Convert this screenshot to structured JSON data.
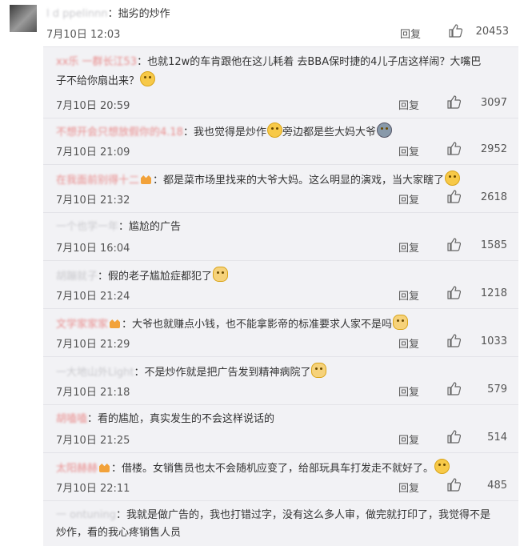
{
  "top_comment": {
    "username": "l  d  ppelinnn",
    "colon_text": "：拙劣的炒作",
    "time": "7月10日 12:03",
    "reply_label": "回复",
    "likes": "20453"
  },
  "replies": [
    {
      "username": "xx乐  一群长江53",
      "text_line1": "：也就12w的车肯跟他在这儿耗着 去BBA保时捷的4儿子店这样闹？大嘴巴",
      "text_line2": "子不给你扇出来？",
      "emoji": "wink-face-icon",
      "time": "7月10日 20:59",
      "reply_label": "回复",
      "likes": "3097"
    },
    {
      "username": "不想开会只想放假你的4.18",
      "text_line1": "：我也觉得是炒作",
      "text_after_emoji": "旁边都是些大妈大爷",
      "emoji": "sleepy-face-icon",
      "emoji2": "crying-face-icon",
      "time": "7月10日 21:09",
      "reply_label": "回复",
      "likes": "2952"
    },
    {
      "username": "在我面前别得十二",
      "text_line1": "：都是菜市场里找来的大爷大妈。这么明显的演戏，当大家瞎了",
      "emoji": "laughing-face-icon",
      "time": "7月10日 21:32",
      "reply_label": "回复",
      "likes": "2618"
    },
    {
      "username": "一个也学一年",
      "text_line1": "：尴尬的广告",
      "time": "7月10日 16:04",
      "reply_label": "回复",
      "likes": "1585"
    },
    {
      "username": "胡蹦就子",
      "text_line1": "：假的老子尴尬症都犯了",
      "emoji": "cat-face-icon",
      "time": "7月10日 21:24",
      "reply_label": "回复",
      "likes": "1218"
    },
    {
      "username": "文学家家家",
      "text_line1": "：大爷也就赚点小钱，也不能拿影帝的标准要求人家不是吗",
      "emoji": "cat-face-icon",
      "time": "7月10日 21:29",
      "reply_label": "回复",
      "likes": "1033"
    },
    {
      "username": "一大地山外Light",
      "text_line1": "：不是炒作就是把广告发到精神病院了",
      "emoji": "cat-face-icon",
      "time": "7月10日 21:18",
      "reply_label": "回复",
      "likes": "579"
    },
    {
      "username": "胡嗑嗑",
      "text_line1": "：看的尴尬，真实发生的不会这样说话的",
      "time": "7月10日 21:25",
      "reply_label": "回复",
      "likes": "514"
    },
    {
      "username": "太阳赫赫",
      "text_line1": "：借楼。女销售员也太不会随机应变了，给部玩具车打发走不就好了。",
      "emoji": "shy-face-icon",
      "time": "7月10日 22:11",
      "reply_label": "回复",
      "likes": "485"
    },
    {
      "username": "一  ontuning",
      "text_line1": "：我就是做广告的，我也打错过字，没有这么多人审，做完就打印了，我觉得不是",
      "text_line2": "炒作，看的我心疼销售人员"
    }
  ]
}
